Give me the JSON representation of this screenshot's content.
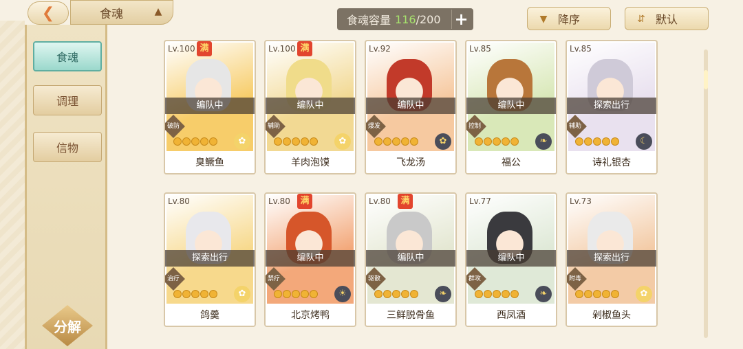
{
  "header": {
    "back_icon": "back-arrow-icon",
    "title": "食魂",
    "title_icon": "pavilion-icon",
    "capacity_label": "食魂容量",
    "capacity_current": "116",
    "capacity_total": "/200",
    "plus_label": "+",
    "sort_order_label": "降序",
    "sort_order_icon": "triangle-down-icon",
    "sort_default_label": "默认",
    "sort_default_icon": "swap-icon"
  },
  "sidebar": {
    "items": [
      {
        "label": "食魂",
        "active": true
      },
      {
        "label": "调理",
        "active": false
      },
      {
        "label": "信物",
        "active": false
      }
    ],
    "decompose_label": "分解"
  },
  "cards": [
    {
      "level": "Lv.100",
      "full": "满",
      "status": "编队中",
      "role": "破防",
      "stars": 5,
      "element": "flower-icon",
      "name": "臭鳜鱼",
      "bg": "#f7cd6a",
      "hair": "#e6e6e6",
      "elem_bg": "#f4d36a",
      "elem_fg": "#ffffff"
    },
    {
      "level": "Lv.100",
      "full": "满",
      "status": "编队中",
      "role": "辅助",
      "stars": 5,
      "element": "flower-icon",
      "name": "羊肉泡馍",
      "bg": "#f2d993",
      "hair": "#f0dc8a",
      "elem_bg": "#f4d36a",
      "elem_fg": "#ffffff"
    },
    {
      "level": "Lv.92",
      "full": "",
      "status": "编队中",
      "role": "爆发",
      "stars": 5,
      "element": "flower-icon",
      "name": "飞龙汤",
      "bg": "#f6c9a0",
      "hair": "#c23a2a",
      "elem_bg": "#4a4d5a",
      "elem_fg": "#f4d36a"
    },
    {
      "level": "Lv.85",
      "full": "",
      "status": "编队中",
      "role": "控制",
      "stars": 5,
      "element": "leaf-icon",
      "name": "福公",
      "bg": "#d9e8b8",
      "hair": "#b8763a",
      "elem_bg": "#4a4d5a",
      "elem_fg": "#f4d36a"
    },
    {
      "level": "Lv.85",
      "full": "",
      "status": "探索出行",
      "role": "辅助",
      "stars": 5,
      "element": "moon-icon",
      "name": "诗礼银杏",
      "bg": "#e9e1ef",
      "hair": "#cfcad8",
      "elem_bg": "#4a4d5a",
      "elem_fg": "#f4d36a"
    },
    {
      "level": "Lv.80",
      "full": "",
      "status": "探索出行",
      "role": "治疗",
      "stars": 5,
      "element": "flower-icon",
      "name": "鸽羹",
      "bg": "#f7d98c",
      "hair": "#e8e8ec",
      "elem_bg": "#f4d36a",
      "elem_fg": "#ffffff"
    },
    {
      "level": "Lv.80",
      "full": "满",
      "status": "编队中",
      "role": "禁疗",
      "stars": 5,
      "element": "sun-icon",
      "name": "北京烤鸭",
      "bg": "#f3a87a",
      "hair": "#d6562a",
      "elem_bg": "#4a4d5a",
      "elem_fg": "#f4d36a"
    },
    {
      "level": "Lv.80",
      "full": "满",
      "status": "编队中",
      "role": "驱散",
      "stars": 5,
      "element": "leaf-icon",
      "name": "三鲜脱骨鱼",
      "bg": "#e4e7d2",
      "hair": "#c9c9c9",
      "elem_bg": "#4a4d5a",
      "elem_fg": "#f4d36a"
    },
    {
      "level": "Lv.77",
      "full": "",
      "status": "编队中",
      "role": "群攻",
      "stars": 5,
      "element": "leaf-icon",
      "name": "西凤酒",
      "bg": "#dfe9d7",
      "hair": "#3a3a3e",
      "elem_bg": "#4a4d5a",
      "elem_fg": "#f4d36a"
    },
    {
      "level": "Lv.73",
      "full": "",
      "status": "探索出行",
      "role": "附毒",
      "stars": 5,
      "element": "flower-icon",
      "name": "剁椒鱼头",
      "bg": "#f3cba6",
      "hair": "#eaeaea",
      "elem_bg": "#f4d36a",
      "elem_fg": "#ffffff"
    }
  ]
}
